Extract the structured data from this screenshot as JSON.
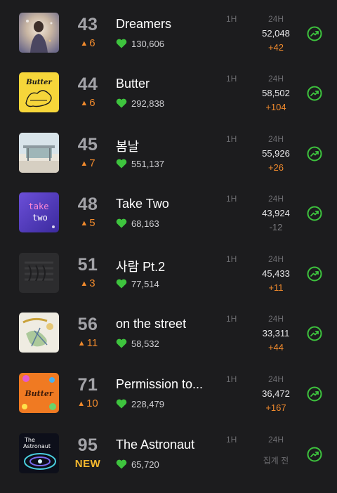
{
  "columns": {
    "one_hour": "1H",
    "twenty_four_hours": "24H"
  },
  "colors": {
    "accent_green": "#3ec43e",
    "rank_up_orange": "#f08a2d",
    "new_yellow": "#f5b82e",
    "background": "#1c1c1e"
  },
  "songs": [
    {
      "rank": "43",
      "change": "6",
      "title": "Dreamers",
      "likes": "130,606",
      "count_24h": "52,048",
      "delta_24h": "+42"
    },
    {
      "rank": "44",
      "change": "6",
      "title": "Butter",
      "likes": "292,838",
      "count_24h": "58,502",
      "delta_24h": "+104"
    },
    {
      "rank": "45",
      "change": "7",
      "title": "봄날",
      "likes": "551,137",
      "count_24h": "55,926",
      "delta_24h": "+26"
    },
    {
      "rank": "48",
      "change": "5",
      "title": "Take Two",
      "likes": "68,163",
      "count_24h": "43,924",
      "delta_24h": "-12"
    },
    {
      "rank": "51",
      "change": "3",
      "title": "사람 Pt.2",
      "likes": "77,514",
      "count_24h": "45,433",
      "delta_24h": "+11"
    },
    {
      "rank": "56",
      "change": "11",
      "title": "on the street",
      "likes": "58,532",
      "count_24h": "33,311",
      "delta_24h": "+44"
    },
    {
      "rank": "71",
      "change": "10",
      "title": "Permission to...",
      "likes": "228,479",
      "count_24h": "36,472",
      "delta_24h": "+167"
    },
    {
      "rank": "95",
      "change": "NEW",
      "title": "The Astronaut",
      "likes": "65,720",
      "count_24h": "",
      "delta_24h": "집계 전"
    }
  ],
  "album_art_text": {
    "butter": "Butter",
    "take_two": [
      "take",
      "two"
    ],
    "butter2": "Butter",
    "astronaut": [
      "The",
      "Astronaut"
    ]
  },
  "icons": {
    "change_up": "▲",
    "heart": "heart-icon",
    "trend": "trend-up-icon"
  }
}
